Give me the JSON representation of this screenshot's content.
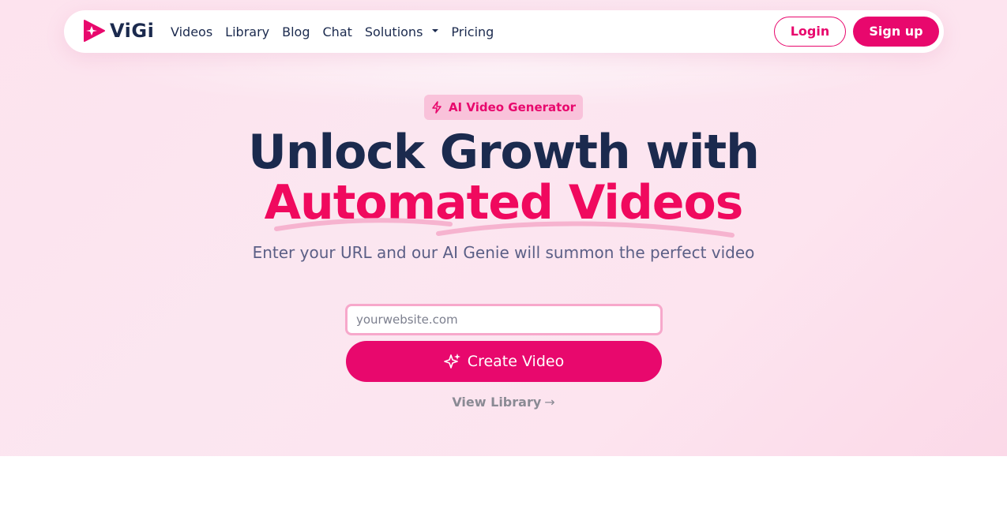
{
  "brand": {
    "name": "ViGi",
    "accent": "#e8086d",
    "headline_color": "#1b2a4e"
  },
  "nav": {
    "items": [
      {
        "label": "Videos"
      },
      {
        "label": "Library"
      },
      {
        "label": "Blog"
      },
      {
        "label": "Chat"
      },
      {
        "label": "Solutions"
      },
      {
        "label": "Pricing"
      }
    ],
    "login_label": "Login",
    "signup_label": "Sign up"
  },
  "hero": {
    "badge": {
      "icon": "lightning-icon",
      "label": "AI Video Generator"
    },
    "title_line1": "Unlock Growth with",
    "title_line2": "Automated Videos",
    "subtitle": "Enter your URL and our AI Genie will summon the perfect video",
    "url_input": {
      "placeholder": "yourwebsite.com",
      "value": ""
    },
    "create_button": {
      "icon": "sparkle-icon",
      "label": "Create Video"
    },
    "view_library": {
      "label": "View Library",
      "arrow": "→"
    }
  }
}
